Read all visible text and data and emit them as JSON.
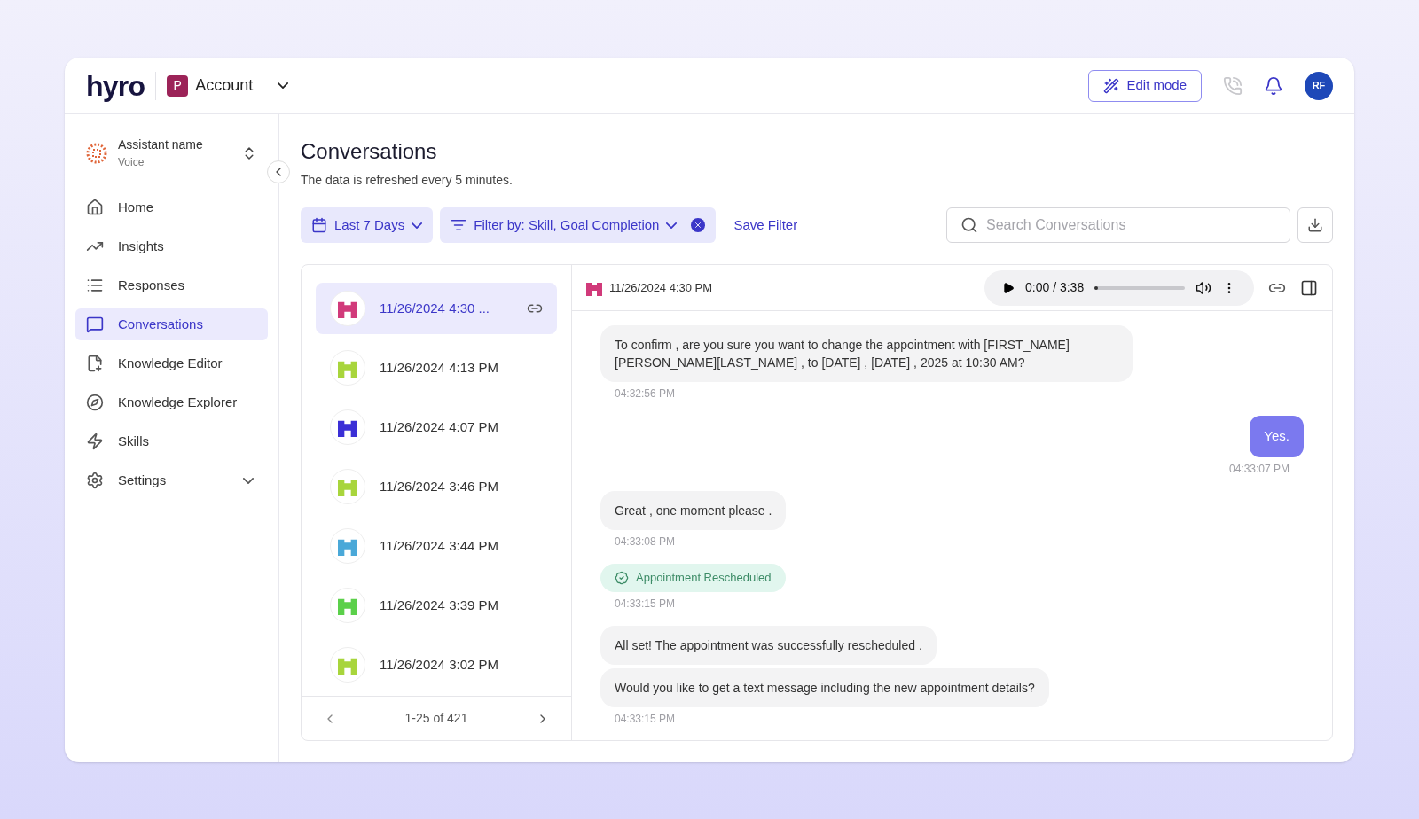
{
  "header": {
    "logo": "hyro",
    "account": {
      "initial": "P",
      "name": "Account"
    },
    "edit_button": "Edit mode",
    "avatar": "RF"
  },
  "sidebar": {
    "assistant": {
      "name": "Assistant name",
      "type": "Voice"
    },
    "items": [
      {
        "label": "Home",
        "selected": false,
        "expandable": false
      },
      {
        "label": "Insights",
        "selected": false,
        "expandable": false
      },
      {
        "label": "Responses",
        "selected": false,
        "expandable": false
      },
      {
        "label": "Conversations",
        "selected": true,
        "expandable": false
      },
      {
        "label": "Knowledge Editor",
        "selected": false,
        "expandable": false
      },
      {
        "label": "Knowledge Explorer",
        "selected": false,
        "expandable": false
      },
      {
        "label": "Skills",
        "selected": false,
        "expandable": false
      },
      {
        "label": "Settings",
        "selected": false,
        "expandable": true
      }
    ]
  },
  "page": {
    "title": "Conversations",
    "subtitle": "The data is refreshed every 5 minutes."
  },
  "filters": {
    "date": "Last 7 Days",
    "filter": "Filter by: Skill, Goal Completion",
    "save": "Save Filter",
    "search": {
      "placeholder": "Search Conversations"
    }
  },
  "conversations": [
    {
      "time": "11/26/2024 4:30 ...",
      "color": "#d13a7a",
      "selected": true
    },
    {
      "time": "11/26/2024 4:13 PM",
      "color": "#a8d53c",
      "selected": false
    },
    {
      "time": "11/26/2024 4:07 PM",
      "color": "#3b2fd6",
      "selected": false
    },
    {
      "time": "11/26/2024 3:46 PM",
      "color": "#a8d53c",
      "selected": false
    },
    {
      "time": "11/26/2024 3:44 PM",
      "color": "#4aa8d8",
      "selected": false
    },
    {
      "time": "11/26/2024 3:39 PM",
      "color": "#5bd04a",
      "selected": false
    },
    {
      "time": "11/26/2024 3:02 PM",
      "color": "#a8d53c",
      "selected": false
    }
  ],
  "pagination": "1-25 of 421",
  "chat": {
    "time": "11/26/2024 4:30 PM",
    "color": "#d13a7a",
    "player": {
      "time": "0:00 / 3:38",
      "level": 0
    },
    "messages": [
      {
        "kind": "bot",
        "text": "To confirm , are you sure you want to change the appointment with [FIRST_NAME] [PERSON_NAME][LAST_NAME] , to [DATE] , [DATE] , 2025 at 10:30 AM?",
        "time": "04:32:56 PM"
      },
      {
        "kind": "user",
        "text": "Yes.",
        "time": "04:33:07 PM"
      },
      {
        "kind": "bot",
        "text": "Great , one moment please .",
        "time": "04:33:08 PM"
      },
      {
        "kind": "event",
        "text": "Appointment Rescheduled",
        "time": "04:33:15 PM"
      },
      {
        "kind": "bot",
        "text": "All set! The appointment was successfully rescheduled ."
      },
      {
        "kind": "bot",
        "text": "Would you like to get a text message including the new appointment details?",
        "time": "04:33:15 PM"
      }
    ]
  }
}
